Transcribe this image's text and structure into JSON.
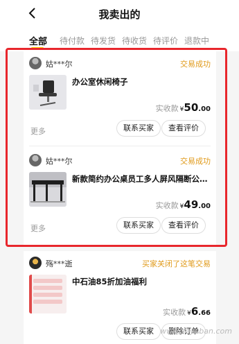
{
  "header": {
    "title": "我卖出的"
  },
  "tabs": [
    {
      "label": "全部",
      "active": true
    },
    {
      "label": "待付款"
    },
    {
      "label": "待发货"
    },
    {
      "label": "待收货"
    },
    {
      "label": "待评价"
    },
    {
      "label": "退款中"
    }
  ],
  "orders": [
    {
      "seller": "姑***尔",
      "status": "交易成功",
      "title": "办公室休闲椅子",
      "price_label": "实收款",
      "currency": "¥",
      "price_int": "50",
      "price_dec": ".00",
      "more": "更多",
      "buttons": [
        "联系买家",
        "查看评价"
      ]
    },
    {
      "seller": "姑***尔",
      "status": "交易成功",
      "title": "新款简约办公桌员工多人屏风隔断公司…",
      "price_label": "实收款",
      "currency": "¥",
      "price_int": "49",
      "price_dec": ".00",
      "more": "更多",
      "buttons": [
        "联系买家",
        "查看评价"
      ]
    },
    {
      "seller": "殇***逝",
      "status": "买家关闭了这笔交易",
      "title": "中石油85折加油福利",
      "price_label": "实收款",
      "currency": "¥",
      "price_int": "6",
      "price_dec": ".66",
      "buttons": [
        "联系买家",
        "删除订单"
      ]
    }
  ],
  "watermark": "www.lieyuban.com",
  "colors": {
    "status": "#e09a1a",
    "highlight": "#e8262c",
    "tab_underline": "#ffd400"
  }
}
